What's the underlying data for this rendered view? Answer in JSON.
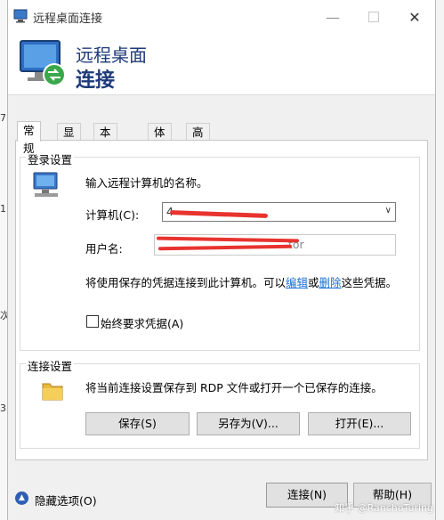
{
  "window": {
    "title": "远程桌面连接"
  },
  "header": {
    "line1": "远程桌面",
    "line2": "连接"
  },
  "tabs": [
    {
      "label": "常规",
      "active": true
    },
    {
      "label": "显示"
    },
    {
      "label": "本地资源"
    },
    {
      "label": "体验"
    },
    {
      "label": "高级"
    }
  ],
  "login": {
    "group_label": "登录设置",
    "instruction": "输入远程计算机的名称。",
    "computer_label": "计算机(C):",
    "computer_value": "4",
    "username_label": "用户名:",
    "username_value": "tor",
    "info_prefix": "将使用保存的凭据连接到此计算机。可以",
    "edit_link": "编辑",
    "or_text": "或",
    "delete_link": "删除",
    "info_suffix": "这些凭据。",
    "always_ask_label": "始终要求凭据(A)",
    "always_ask_checked": false
  },
  "connection": {
    "group_label": "连接设置",
    "description": "将当前连接设置保存到 RDP 文件或打开一个已保存的连接。",
    "save_label": "保存(S)",
    "save_as_label": "另存为(V)...",
    "open_label": "打开(E)..."
  },
  "footer": {
    "hide_options_label": "隐藏选项(O)",
    "connect_label": "连接(N)",
    "help_label": "帮助(H)",
    "watermark": "知乎 @RanchoTuring"
  },
  "background": {
    "digits": [
      "7",
      "1",
      "次",
      "3"
    ]
  },
  "colors": {
    "header_text": "#1e3a7a",
    "link": "#1a6fd6",
    "redaction": "#e8332e"
  }
}
